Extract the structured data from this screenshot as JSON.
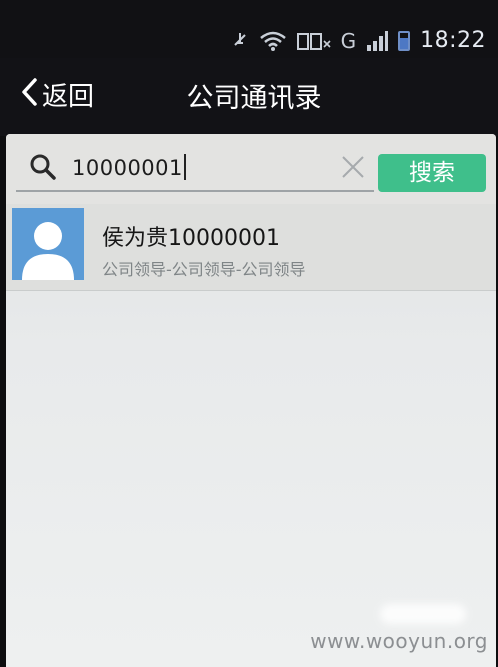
{
  "status_bar": {
    "time": "18:22",
    "network": "G",
    "icons": [
      "mute-icon",
      "wifi-icon",
      "sim-icon",
      "signal-icon",
      "battery-icon"
    ]
  },
  "nav_bar": {
    "back_label": "返回",
    "title": "公司通讯录"
  },
  "search": {
    "query": "10000001",
    "button_label": "搜索"
  },
  "results": [
    {
      "name": "侯为贵10000001",
      "department": "公司领导-公司领导-公司领导"
    }
  ],
  "watermark": "www.wooyun.org",
  "colors": {
    "accent_green": "#3fbf8b",
    "avatar_blue": "#5b9bd6",
    "nav_background": "#121216"
  }
}
